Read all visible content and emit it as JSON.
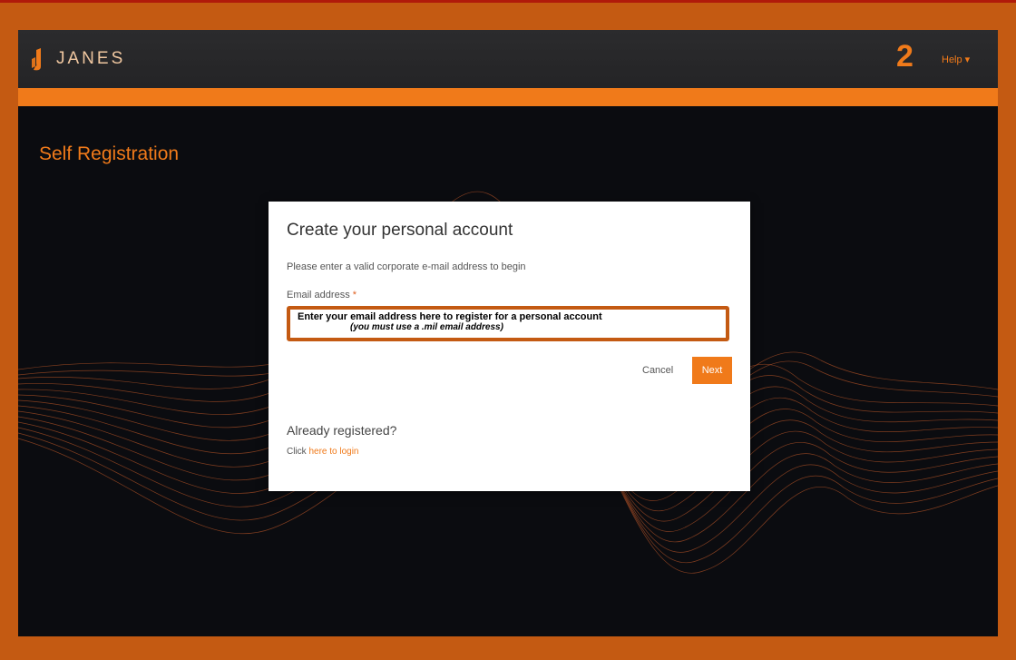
{
  "header": {
    "logo_text": "JANES",
    "step_number": "2",
    "help_label": "Help ▾"
  },
  "page": {
    "title": "Self Registration"
  },
  "dialog": {
    "title": "Create your personal account",
    "instructions": "Please enter a valid corporate e-mail address to begin",
    "email_label": "Email address",
    "required_marker": "*",
    "email_hint_line1": "Enter your email address here to register for a personal account",
    "email_hint_line2": "(you must use a .mil email address)",
    "cancel_label": "Cancel",
    "next_label": "Next",
    "already_heading": "Already registered?",
    "login_prefix": "Click",
    "login_link": "here to login"
  },
  "colors": {
    "frame": "#c45a12",
    "accent": "#f07a1a",
    "topbar": "#2b2b2d",
    "background": "#0b0c10"
  }
}
